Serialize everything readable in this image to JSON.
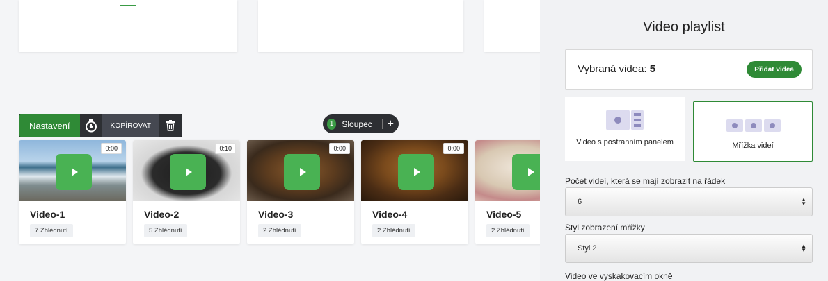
{
  "toolbar": {
    "settings_label": "Nastavení",
    "copy_label": "KOPÍROVAT"
  },
  "column_pill": {
    "number": "1",
    "label": "Sloupec",
    "add": "+"
  },
  "videos": [
    {
      "title": "Video-1",
      "views": "7 Zhlédnutí",
      "duration": "0:00"
    },
    {
      "title": "Video-2",
      "views": "5 Zhlédnutí",
      "duration": "0:10"
    },
    {
      "title": "Video-3",
      "views": "2 Zhlédnutí",
      "duration": "0:00"
    },
    {
      "title": "Video-4",
      "views": "2 Zhlédnutí",
      "duration": "0:00"
    },
    {
      "title": "Video-5",
      "views": "2 Zhlédnutí",
      "duration": ""
    }
  ],
  "panel": {
    "title": "Video playlist",
    "selected_label": "Vybraná videa:",
    "selected_count": "5",
    "add_button": "Přidat videa",
    "layout_option_1": "Video s postranním panelem",
    "layout_option_2": "Mřížka videí",
    "per_row_label": "Počet videí, která se mají zobrazit na řádek",
    "per_row_value": "6",
    "grid_style_label": "Styl zobrazení mřížky",
    "grid_style_value": "Styl 2",
    "popup_label": "Video ve vyskakovacím okně"
  },
  "colors": {
    "accent_green": "#2f8a36",
    "play_green": "#49b253",
    "dark_toolbar": "#2d2f33"
  }
}
